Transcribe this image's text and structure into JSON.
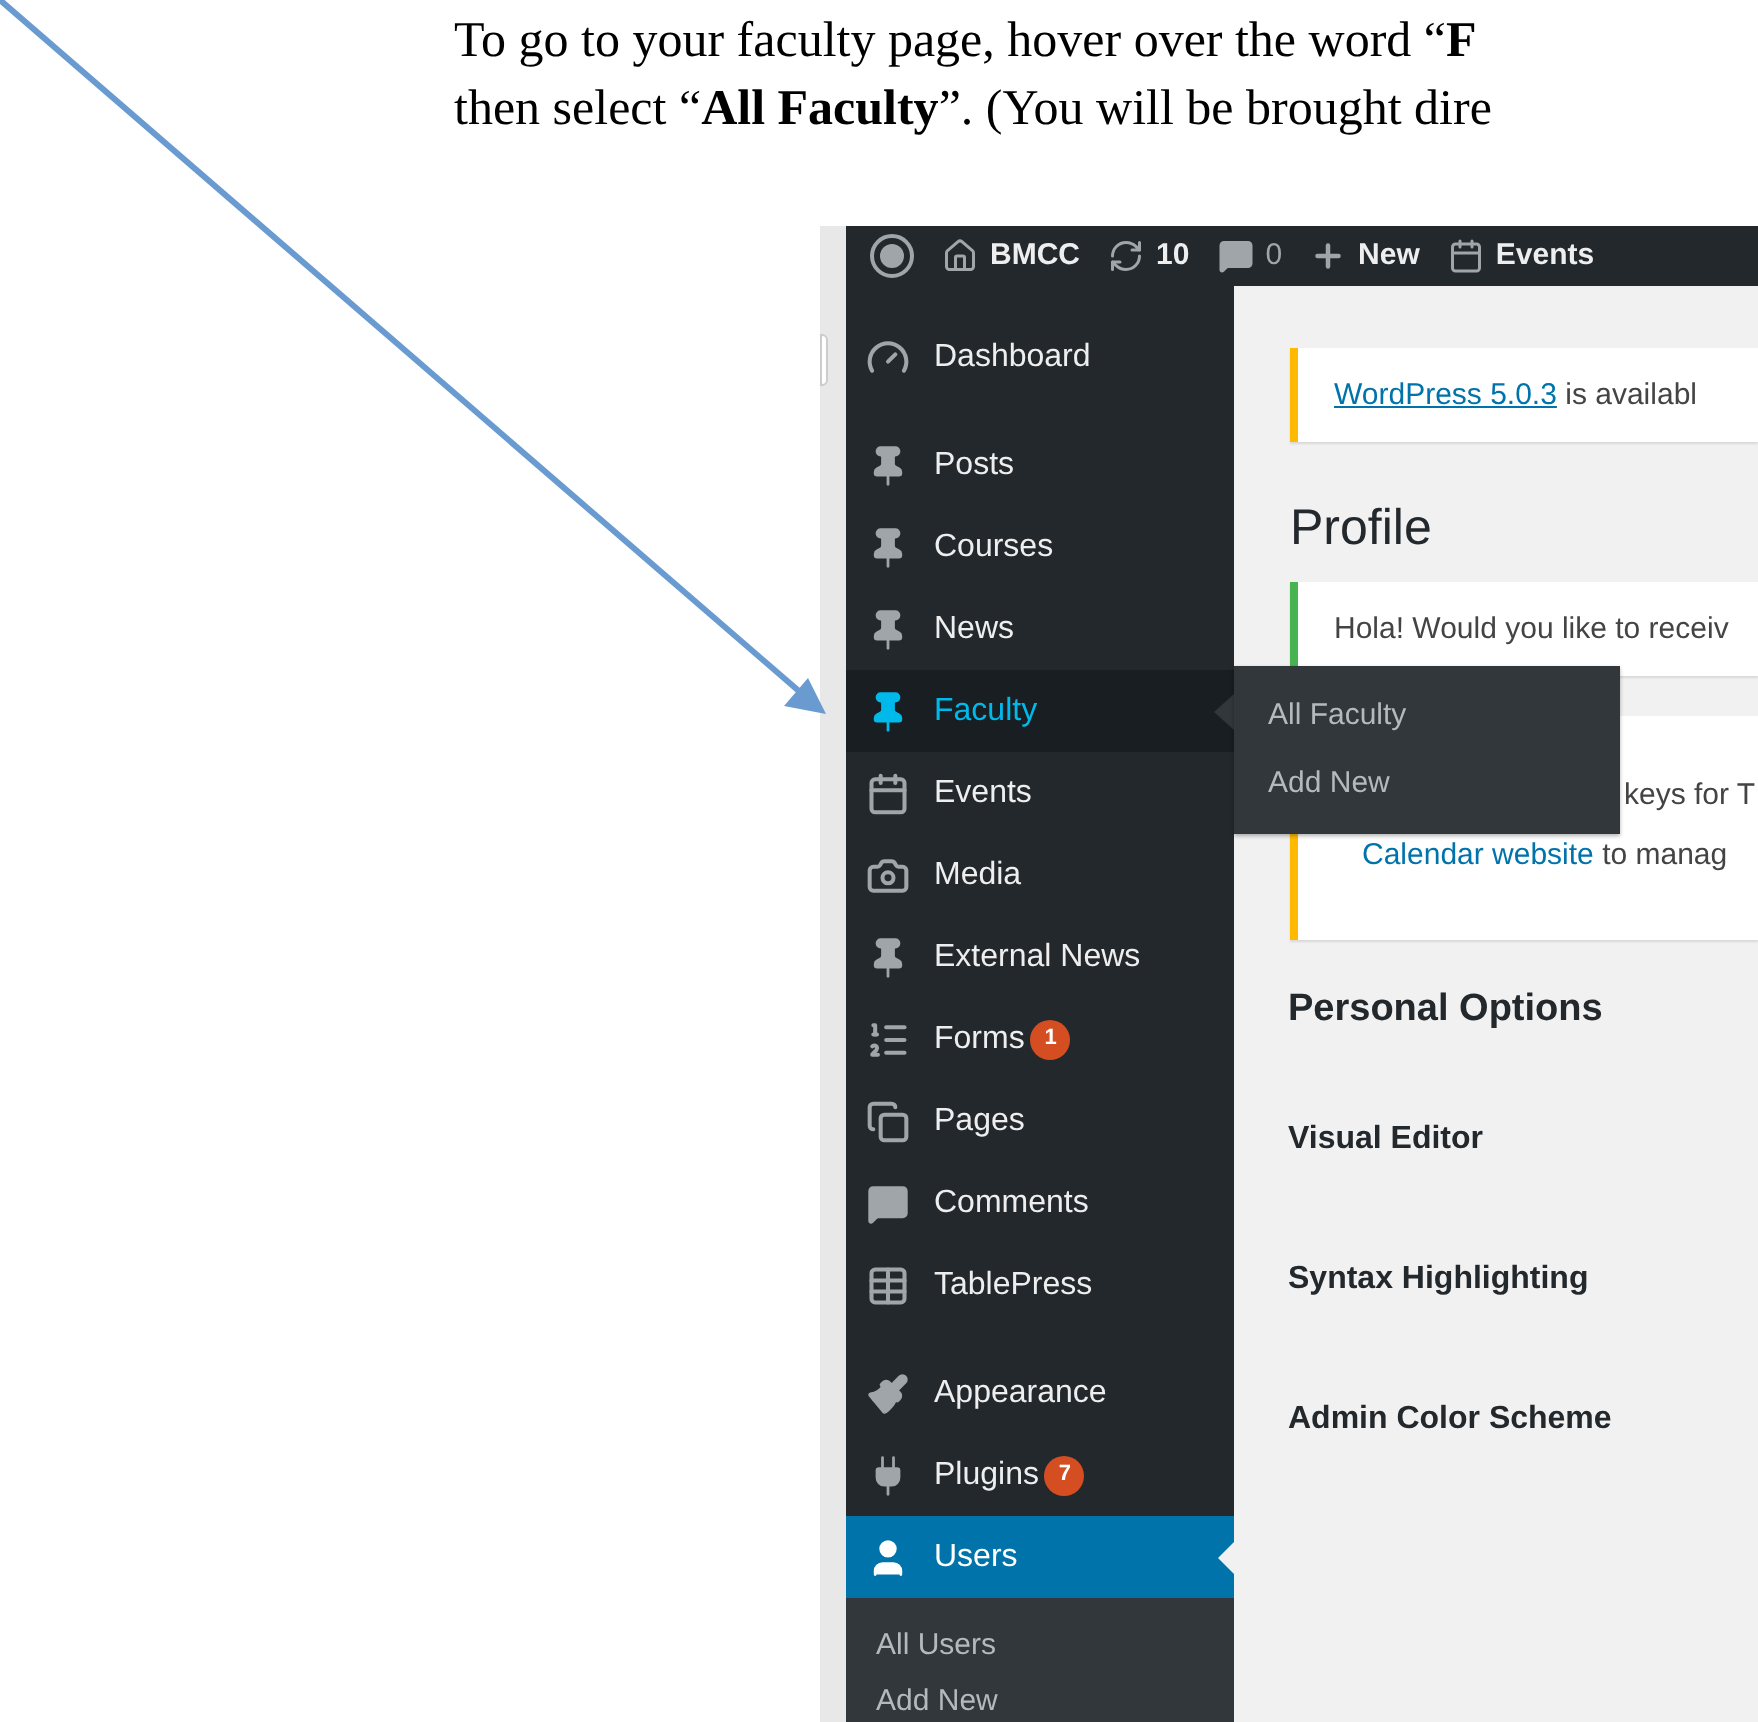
{
  "instructions": [
    "To go to your faculty page, hover over the word “**F**",
    "then select “**All Faculty**”. (You will be brought dire"
  ],
  "toolbar": [
    {
      "kind": "logo"
    },
    {
      "kind": "home",
      "label": "BMCC"
    },
    {
      "kind": "updates",
      "label": "10"
    },
    {
      "kind": "comments",
      "label": "0"
    },
    {
      "kind": "new",
      "label": "New"
    },
    {
      "kind": "events",
      "label": "Events"
    }
  ],
  "sidebar": {
    "groups": [
      [
        {
          "label": "Dashboard",
          "selected": false,
          "hovered": false
        }
      ],
      [
        {
          "label": "Posts",
          "selected": false,
          "hovered": false
        },
        {
          "label": "Courses",
          "selected": false,
          "hovered": false
        },
        {
          "label": "News",
          "selected": false,
          "hovered": false
        },
        {
          "label": "Faculty",
          "selected": false,
          "hovered": true,
          "flyout": [
            "All Faculty",
            "Add New"
          ]
        },
        {
          "label": "Events",
          "selected": false,
          "hovered": false
        },
        {
          "label": "Media",
          "selected": false,
          "hovered": false
        },
        {
          "label": "External News",
          "selected": false,
          "hovered": false
        },
        {
          "label": "Forms",
          "selected": false,
          "hovered": false,
          "badge": "1"
        },
        {
          "label": "Pages",
          "selected": false,
          "hovered": false
        },
        {
          "label": "Comments",
          "selected": false,
          "hovered": false
        },
        {
          "label": "TablePress",
          "selected": false,
          "hovered": false
        }
      ],
      [
        {
          "label": "Appearance",
          "selected": false,
          "hovered": false
        },
        {
          "label": "Plugins",
          "selected": false,
          "hovered": false,
          "badge": "7"
        },
        {
          "label": "Users",
          "selected": true,
          "hovered": false,
          "children": [
            "All Users",
            "Add New"
          ]
        }
      ]
    ]
  },
  "notices": [
    {
      "color": "#ffb900",
      "lines": [
        [
          {
            "kind": "link",
            "text": "WordPress 5.0.3"
          },
          {
            "kind": "text",
            "text": " is availabl"
          }
        ]
      ]
    },
    {
      "color": "#46b450",
      "lines": [
        [
          {
            "kind": "text",
            "text": "Hola! Would you like to receiv"
          }
        ]
      ]
    },
    {
      "color": "#ffb900",
      "lines": [
        [
          {
            "kind": "text",
            "text": "keys for T"
          }
        ],
        [
          {
            "kind": "link",
            "text": "Calendar website"
          },
          {
            "kind": "text",
            "text": " to manag"
          }
        ]
      ]
    }
  ],
  "page_title": "Profile",
  "section_title": "Personal Options",
  "fields": [
    "Visual Editor",
    "Syntax Highlighting",
    "Admin Color Scheme"
  ]
}
